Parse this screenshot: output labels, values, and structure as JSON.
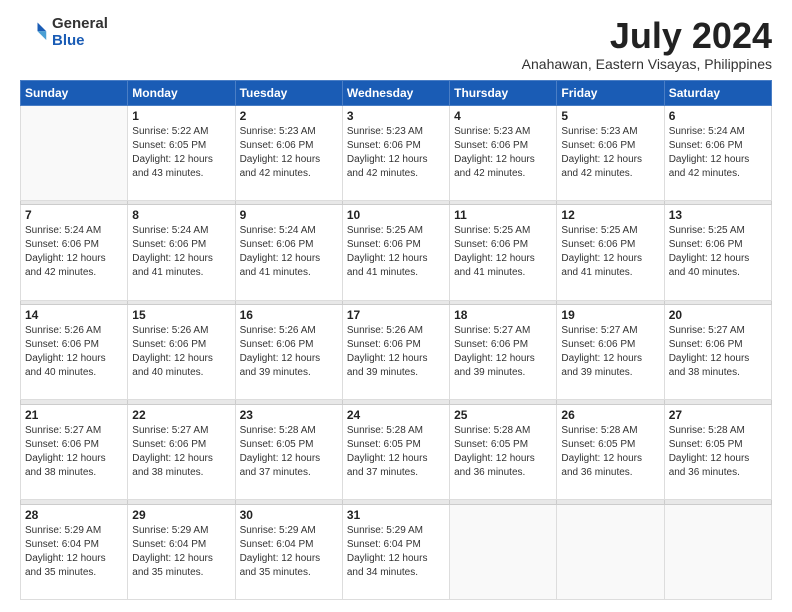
{
  "header": {
    "logo_general": "General",
    "logo_blue": "Blue",
    "main_title": "July 2024",
    "subtitle": "Anahawan, Eastern Visayas, Philippines"
  },
  "calendar": {
    "days_of_week": [
      "Sunday",
      "Monday",
      "Tuesday",
      "Wednesday",
      "Thursday",
      "Friday",
      "Saturday"
    ],
    "weeks": [
      [
        {
          "day": "",
          "info": ""
        },
        {
          "day": "1",
          "info": "Sunrise: 5:22 AM\nSunset: 6:05 PM\nDaylight: 12 hours\nand 43 minutes."
        },
        {
          "day": "2",
          "info": "Sunrise: 5:23 AM\nSunset: 6:06 PM\nDaylight: 12 hours\nand 42 minutes."
        },
        {
          "day": "3",
          "info": "Sunrise: 5:23 AM\nSunset: 6:06 PM\nDaylight: 12 hours\nand 42 minutes."
        },
        {
          "day": "4",
          "info": "Sunrise: 5:23 AM\nSunset: 6:06 PM\nDaylight: 12 hours\nand 42 minutes."
        },
        {
          "day": "5",
          "info": "Sunrise: 5:23 AM\nSunset: 6:06 PM\nDaylight: 12 hours\nand 42 minutes."
        },
        {
          "day": "6",
          "info": "Sunrise: 5:24 AM\nSunset: 6:06 PM\nDaylight: 12 hours\nand 42 minutes."
        }
      ],
      [
        {
          "day": "7",
          "info": "Sunrise: 5:24 AM\nSunset: 6:06 PM\nDaylight: 12 hours\nand 42 minutes."
        },
        {
          "day": "8",
          "info": "Sunrise: 5:24 AM\nSunset: 6:06 PM\nDaylight: 12 hours\nand 41 minutes."
        },
        {
          "day": "9",
          "info": "Sunrise: 5:24 AM\nSunset: 6:06 PM\nDaylight: 12 hours\nand 41 minutes."
        },
        {
          "day": "10",
          "info": "Sunrise: 5:25 AM\nSunset: 6:06 PM\nDaylight: 12 hours\nand 41 minutes."
        },
        {
          "day": "11",
          "info": "Sunrise: 5:25 AM\nSunset: 6:06 PM\nDaylight: 12 hours\nand 41 minutes."
        },
        {
          "day": "12",
          "info": "Sunrise: 5:25 AM\nSunset: 6:06 PM\nDaylight: 12 hours\nand 41 minutes."
        },
        {
          "day": "13",
          "info": "Sunrise: 5:25 AM\nSunset: 6:06 PM\nDaylight: 12 hours\nand 40 minutes."
        }
      ],
      [
        {
          "day": "14",
          "info": "Sunrise: 5:26 AM\nSunset: 6:06 PM\nDaylight: 12 hours\nand 40 minutes."
        },
        {
          "day": "15",
          "info": "Sunrise: 5:26 AM\nSunset: 6:06 PM\nDaylight: 12 hours\nand 40 minutes."
        },
        {
          "day": "16",
          "info": "Sunrise: 5:26 AM\nSunset: 6:06 PM\nDaylight: 12 hours\nand 39 minutes."
        },
        {
          "day": "17",
          "info": "Sunrise: 5:26 AM\nSunset: 6:06 PM\nDaylight: 12 hours\nand 39 minutes."
        },
        {
          "day": "18",
          "info": "Sunrise: 5:27 AM\nSunset: 6:06 PM\nDaylight: 12 hours\nand 39 minutes."
        },
        {
          "day": "19",
          "info": "Sunrise: 5:27 AM\nSunset: 6:06 PM\nDaylight: 12 hours\nand 39 minutes."
        },
        {
          "day": "20",
          "info": "Sunrise: 5:27 AM\nSunset: 6:06 PM\nDaylight: 12 hours\nand 38 minutes."
        }
      ],
      [
        {
          "day": "21",
          "info": "Sunrise: 5:27 AM\nSunset: 6:06 PM\nDaylight: 12 hours\nand 38 minutes."
        },
        {
          "day": "22",
          "info": "Sunrise: 5:27 AM\nSunset: 6:06 PM\nDaylight: 12 hours\nand 38 minutes."
        },
        {
          "day": "23",
          "info": "Sunrise: 5:28 AM\nSunset: 6:05 PM\nDaylight: 12 hours\nand 37 minutes."
        },
        {
          "day": "24",
          "info": "Sunrise: 5:28 AM\nSunset: 6:05 PM\nDaylight: 12 hours\nand 37 minutes."
        },
        {
          "day": "25",
          "info": "Sunrise: 5:28 AM\nSunset: 6:05 PM\nDaylight: 12 hours\nand 36 minutes."
        },
        {
          "day": "26",
          "info": "Sunrise: 5:28 AM\nSunset: 6:05 PM\nDaylight: 12 hours\nand 36 minutes."
        },
        {
          "day": "27",
          "info": "Sunrise: 5:28 AM\nSunset: 6:05 PM\nDaylight: 12 hours\nand 36 minutes."
        }
      ],
      [
        {
          "day": "28",
          "info": "Sunrise: 5:29 AM\nSunset: 6:04 PM\nDaylight: 12 hours\nand 35 minutes."
        },
        {
          "day": "29",
          "info": "Sunrise: 5:29 AM\nSunset: 6:04 PM\nDaylight: 12 hours\nand 35 minutes."
        },
        {
          "day": "30",
          "info": "Sunrise: 5:29 AM\nSunset: 6:04 PM\nDaylight: 12 hours\nand 35 minutes."
        },
        {
          "day": "31",
          "info": "Sunrise: 5:29 AM\nSunset: 6:04 PM\nDaylight: 12 hours\nand 34 minutes."
        },
        {
          "day": "",
          "info": ""
        },
        {
          "day": "",
          "info": ""
        },
        {
          "day": "",
          "info": ""
        }
      ]
    ]
  }
}
